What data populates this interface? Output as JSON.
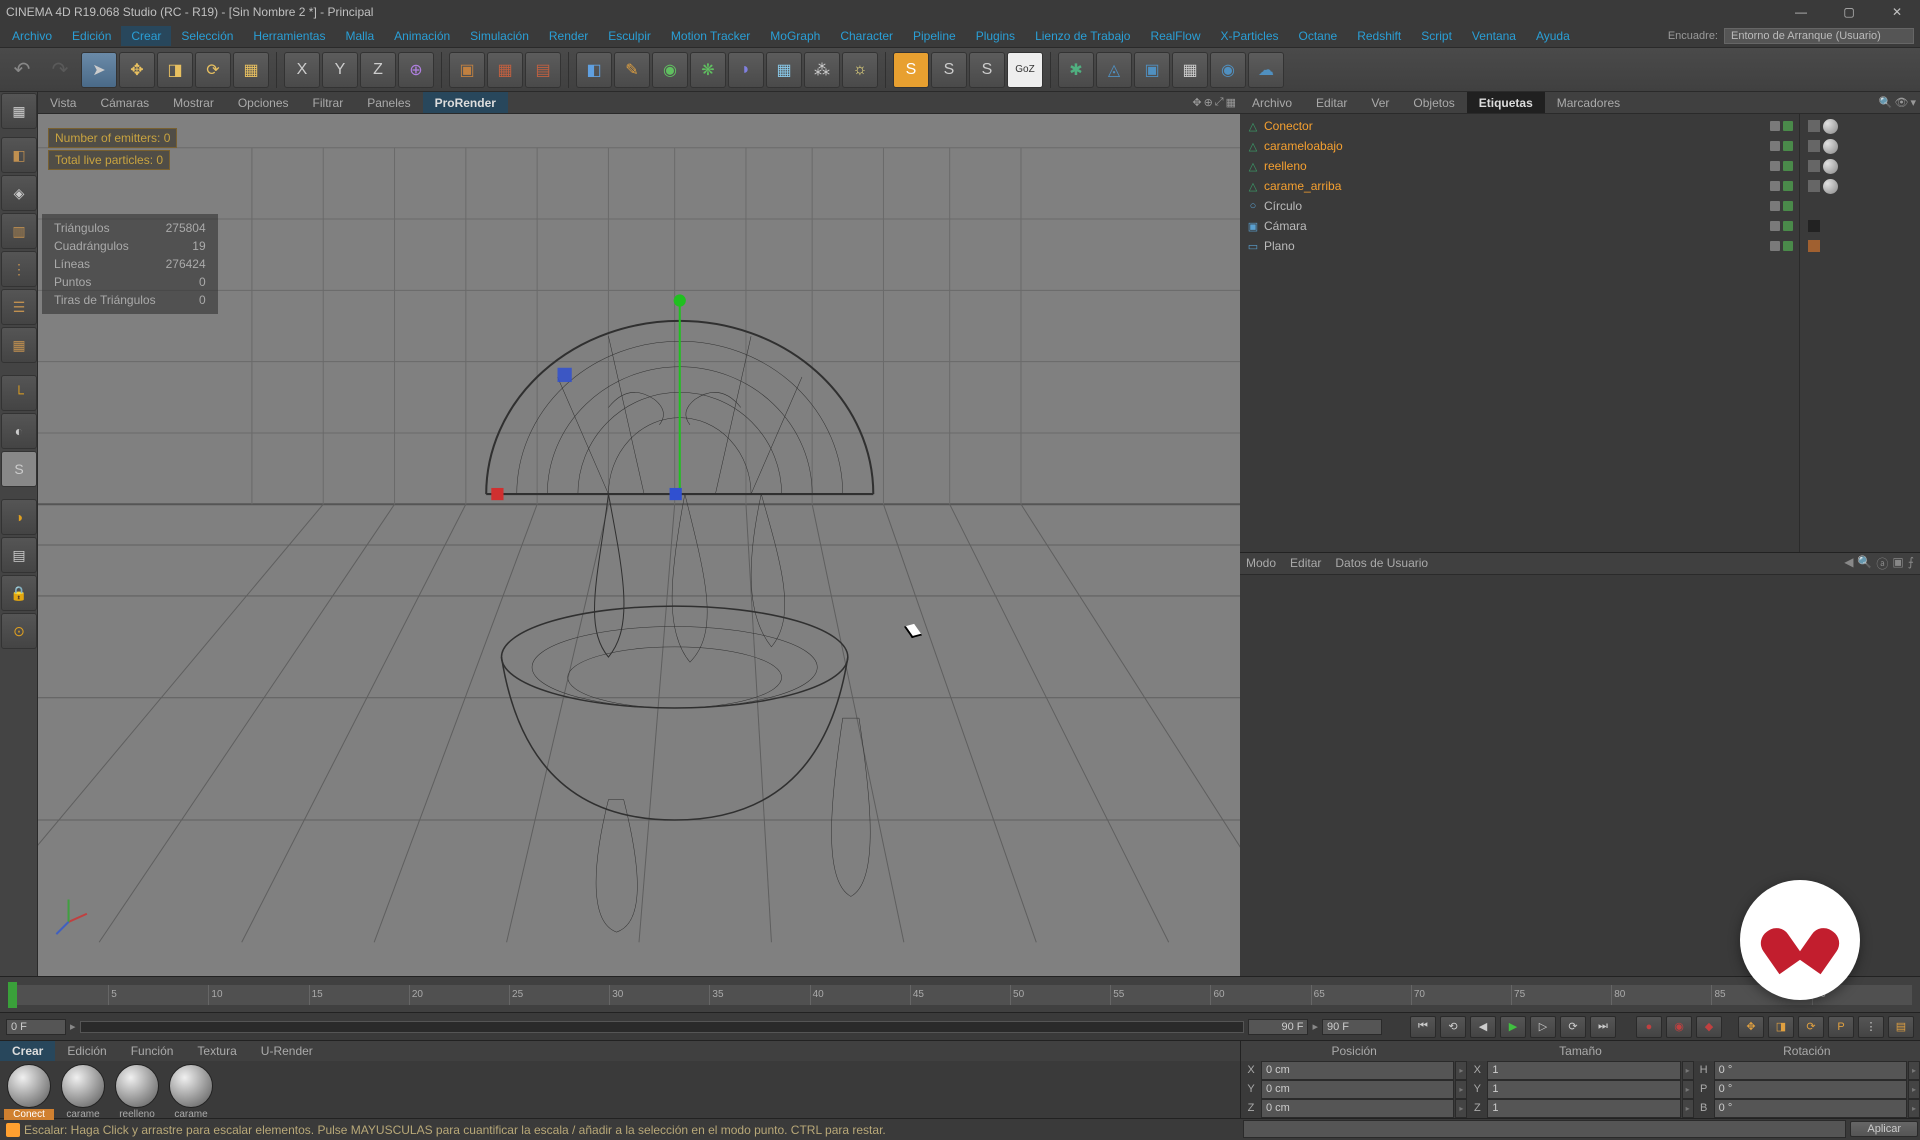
{
  "title": "CINEMA 4D R19.068 Studio (RC - R19) - [Sin Nombre 2 *] - Principal",
  "menu": [
    "Archivo",
    "Edición",
    "Crear",
    "Selección",
    "Herramientas",
    "Malla",
    "Animación",
    "Simulación",
    "Render",
    "Esculpir",
    "Motion Tracker",
    "MoGraph",
    "Character",
    "Pipeline",
    "Plugins",
    "Lienzo de Trabajo",
    "RealFlow",
    "X-Particles",
    "Octane",
    "Redshift",
    "Script",
    "Ventana",
    "Ayuda"
  ],
  "menu_right_label": "Encuadre:",
  "menu_layout": "Entorno de Arranque (Usuario)",
  "vp_tabs": [
    "Vista",
    "Cámaras",
    "Mostrar",
    "Opciones",
    "Filtrar",
    "Paneles",
    "ProRender"
  ],
  "overlay": {
    "emitters": "Number of emitters: 0",
    "particles": "Total live particles: 0"
  },
  "stats": {
    "Triángulos": "275804",
    "Cuadrángulos": "19",
    "Líneas": "276424",
    "Puntos": "0",
    "Tiras de Triángulos": "0"
  },
  "rp_tabs": [
    "Archivo",
    "Editar",
    "Ver",
    "Objetos",
    "Etiquetas",
    "Marcadores"
  ],
  "objects": [
    {
      "name": "Conector",
      "sel": true,
      "icon": "△",
      "ic": "#3aa06a",
      "tag": "ball"
    },
    {
      "name": "carameloabajo",
      "sel": true,
      "icon": "△",
      "ic": "#3aa06a",
      "tag": "ball"
    },
    {
      "name": "reelleno",
      "sel": true,
      "icon": "△",
      "ic": "#3aa06a",
      "tag": "ball"
    },
    {
      "name": "carame_arriba",
      "sel": true,
      "icon": "△",
      "ic": "#3aa06a",
      "tag": "ball"
    },
    {
      "name": "Círculo",
      "sel": false,
      "icon": "○",
      "ic": "#5aa0d0",
      "tag": "none"
    },
    {
      "name": "Cámara",
      "sel": false,
      "icon": "▣",
      "ic": "#5aa0d0",
      "tag": "cam"
    },
    {
      "name": "Plano",
      "sel": false,
      "icon": "▭",
      "ic": "#5aa0d0",
      "tag": "mat"
    }
  ],
  "attr": {
    "tabs": [
      "Modo",
      "Editar",
      "Datos de Usuario"
    ]
  },
  "tl": {
    "ticks": [
      "0",
      "5",
      "10",
      "15",
      "20",
      "25",
      "30",
      "35",
      "40",
      "45",
      "50",
      "55",
      "60",
      "65",
      "70",
      "75",
      "80",
      "85",
      "90"
    ],
    "start": "0 F",
    "end": "90 F",
    "cur": "90 F"
  },
  "mat_tabs": [
    "Crear",
    "Edición",
    "Función",
    "Textura",
    "U-Render"
  ],
  "materials": [
    "Conect",
    "carame",
    "reelleno",
    "carame"
  ],
  "coord": {
    "head": [
      "Posición",
      "Tamaño",
      "Rotación"
    ],
    "rows": [
      {
        "l": "X",
        "p": "0 cm",
        "s": "1",
        "sl": "X",
        "r": "0 °",
        "rl": "H"
      },
      {
        "l": "Y",
        "p": "0 cm",
        "s": "1",
        "sl": "Y",
        "r": "0 °",
        "rl": "P"
      },
      {
        "l": "Z",
        "p": "0 cm",
        "s": "1",
        "sl": "Z",
        "r": "0 °",
        "rl": "B"
      }
    ],
    "apply": "Aplicar"
  },
  "status": "Escalar: Haga Click y arrastre para escalar elementos. Pulse MAYUSCULAS para cuantificar la escala / añadir a la selección en el modo punto. CTRL para restar."
}
